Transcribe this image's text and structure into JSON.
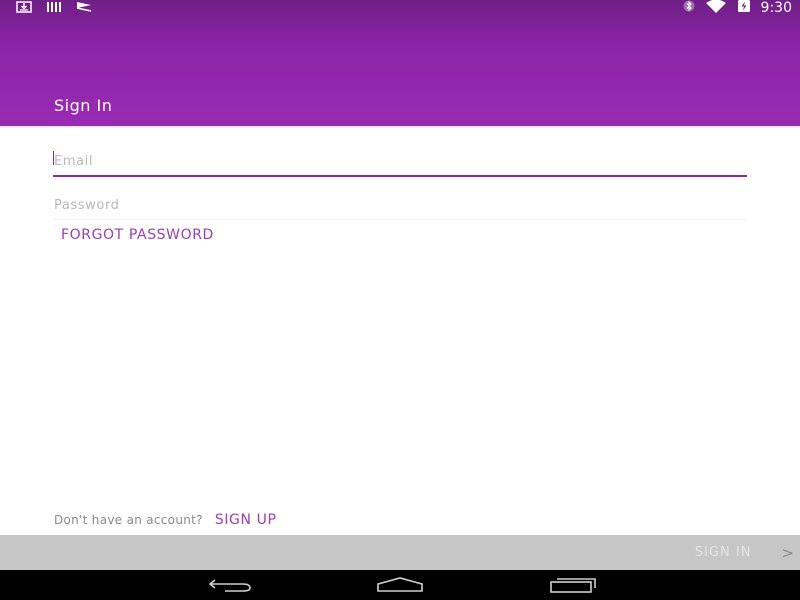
{
  "status_bar": {
    "time": "9:30",
    "left_icons": [
      "download-icon",
      "barcode-icon",
      "signal-flag-icon"
    ],
    "right_icons": [
      "bluetooth-icon",
      "wifi-icon",
      "battery-charging-icon"
    ]
  },
  "header": {
    "title": "Sign In",
    "gradient": [
      "#6f1f86",
      "#9a2bb4"
    ]
  },
  "form": {
    "email_placeholder": "Email",
    "email_value": "",
    "password_placeholder": "Password",
    "password_value": "",
    "forgot_password_label": "FORGOT PASSWORD"
  },
  "footer": {
    "signup_prompt": "Don't have an account?",
    "signup_label": "SIGN UP"
  },
  "action_bar": {
    "signin_label": "SIGN IN",
    "chevron": ">"
  },
  "nav_bar": {
    "icons": [
      "back-icon",
      "home-icon",
      "recents-icon"
    ]
  },
  "colors": {
    "accent": "#9b3db4",
    "action_bar_bg": "#c6c6c6"
  }
}
